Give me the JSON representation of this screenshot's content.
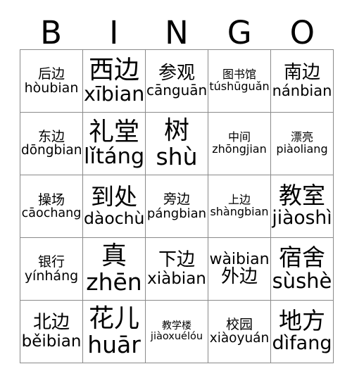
{
  "header": {
    "letters": [
      "B",
      "I",
      "N",
      "G",
      "O"
    ]
  },
  "grid": {
    "rows": 5,
    "columns": 5,
    "border_color": "#8a8a8a",
    "cells": [
      {
        "hanzi": "后边",
        "pinyin": "hòubian",
        "order": "hanzi-first",
        "size": "sm"
      },
      {
        "hanzi": "西边",
        "pinyin": "xībian",
        "order": "hanzi-first",
        "size": "xl"
      },
      {
        "hanzi": "参观",
        "pinyin": "cānguān",
        "order": "hanzi-first",
        "size": "md"
      },
      {
        "hanzi": "图书馆",
        "pinyin": "túshūguǎn",
        "order": "hanzi-first",
        "size": "xs"
      },
      {
        "hanzi": "南边",
        "pinyin": "nánbian",
        "order": "hanzi-first",
        "size": "md"
      },
      {
        "hanzi": "东边",
        "pinyin": "dōngbian",
        "order": "hanzi-first",
        "size": "sm"
      },
      {
        "hanzi": "礼堂",
        "pinyin": "lǐtáng",
        "order": "hanzi-first",
        "size": "xl"
      },
      {
        "hanzi": "树",
        "pinyin": "shù",
        "order": "hanzi-first",
        "size": "xl"
      },
      {
        "hanzi": "中间",
        "pinyin": "zhōngjian",
        "order": "hanzi-first",
        "size": "xs"
      },
      {
        "hanzi": "漂亮",
        "pinyin": "piàoliang",
        "order": "hanzi-first",
        "size": "xs"
      },
      {
        "hanzi": "操场",
        "pinyin": "cāochang",
        "order": "hanzi-first",
        "size": "sm"
      },
      {
        "hanzi": "到处",
        "pinyin": "dàochù",
        "order": "hanzi-first",
        "size": "lg"
      },
      {
        "hanzi": "旁边",
        "pinyin": "pángbian",
        "order": "hanzi-first",
        "size": "sm"
      },
      {
        "hanzi": "上边",
        "pinyin": "shàngbian",
        "order": "hanzi-first",
        "size": "xs"
      },
      {
        "hanzi": "教室",
        "pinyin": "jiàoshì",
        "order": "hanzi-first",
        "size": "lg"
      },
      {
        "hanzi": "银行",
        "pinyin": "yínháng",
        "order": "hanzi-first",
        "size": "sm"
      },
      {
        "hanzi": "真",
        "pinyin": "zhēn",
        "order": "hanzi-first",
        "size": "xl"
      },
      {
        "hanzi": "下边",
        "pinyin": "xiàbian",
        "order": "hanzi-first",
        "size": "md"
      },
      {
        "hanzi": "外边",
        "pinyin": "wàibian",
        "order": "pinyin-first",
        "size": "md"
      },
      {
        "hanzi": "宿舍",
        "pinyin": "sùshè",
        "order": "hanzi-first",
        "size": "lg"
      },
      {
        "hanzi": "北边",
        "pinyin": "běibian",
        "order": "hanzi-first",
        "size": "md"
      },
      {
        "hanzi": "花儿",
        "pinyin": "huār",
        "order": "hanzi-first",
        "size": "xl"
      },
      {
        "hanzi": "教学楼",
        "pinyin": "jiàoxuélóu",
        "order": "hanzi-first",
        "size": "xxs"
      },
      {
        "hanzi": "校园",
        "pinyin": "xiàoyuán",
        "order": "hanzi-first",
        "size": "sm"
      },
      {
        "hanzi": "地方",
        "pinyin": "dìfang",
        "order": "hanzi-first",
        "size": "lg"
      }
    ]
  }
}
